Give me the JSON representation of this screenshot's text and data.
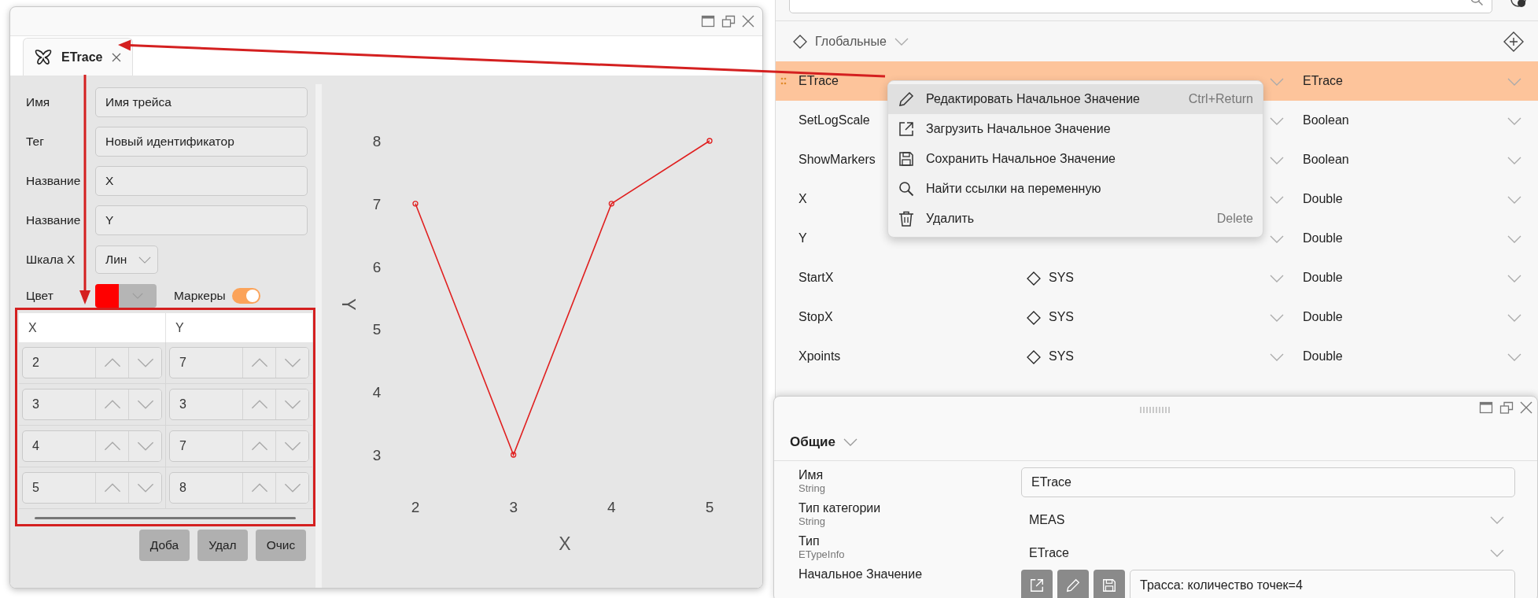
{
  "trace_window": {
    "tab": {
      "label": "ETrace",
      "selected": true
    },
    "form": [
      {
        "label": "Имя",
        "value": "Имя трейса"
      },
      {
        "label": "Тег",
        "value": "Новый идентификатор"
      },
      {
        "label": "Название",
        "value": "X"
      },
      {
        "label": "Название",
        "value": "Y"
      }
    ],
    "scale_x": {
      "label": "Шкала X",
      "value": "Лин"
    },
    "color": {
      "label": "Цвет",
      "color": "#ff0000"
    },
    "markers": {
      "label": "Маркеры",
      "on": true
    },
    "points_table": {
      "columns": [
        "X",
        "Y"
      ],
      "rows": [
        [
          "2",
          "7"
        ],
        [
          "3",
          "3"
        ],
        [
          "4",
          "7"
        ],
        [
          "5",
          "8"
        ]
      ]
    },
    "buttons": [
      "Доба",
      "Удал",
      "Очис"
    ],
    "chart": {
      "chart_data": {
        "type": "line",
        "xlabel": "X",
        "ylabel": "Y",
        "x": [
          2,
          3,
          4,
          5
        ],
        "series": [
          {
            "color": "#e02020",
            "marker": "circle",
            "values": [
              7,
              3,
              7,
              8
            ]
          }
        ],
        "xlim": [
          2,
          5
        ],
        "ylim": [
          3,
          8
        ],
        "xticks": [
          2,
          3,
          4,
          5
        ],
        "yticks": [
          3,
          4,
          5,
          6,
          7,
          8
        ]
      }
    }
  },
  "variables": {
    "group": "Глобальные",
    "rows": [
      {
        "name": "ETrace",
        "type": "ETrace",
        "selected": true
      },
      {
        "name": "SetLogScale",
        "type": "Boolean",
        "selected": false
      },
      {
        "name": "ShowMarkers",
        "type": "Boolean",
        "selected": false
      },
      {
        "name": "X",
        "type": "Double",
        "selected": false
      },
      {
        "name": "Y",
        "type": "Double",
        "selected": false
      },
      {
        "name": "StartX",
        "category": "SYS",
        "type": "Double",
        "selected": false
      },
      {
        "name": "StopX",
        "category": "SYS",
        "type": "Double",
        "selected": false
      },
      {
        "name": "Xpoints",
        "category": "SYS",
        "type": "Double",
        "selected": false
      }
    ]
  },
  "context_menu": [
    {
      "label": "Редактировать Начальное Значение",
      "shortcut": "Ctrl+Return",
      "selected": true
    },
    {
      "label": "Загрузить Начальное Значение",
      "selected": false
    },
    {
      "label": "Сохранить Начальное Значение",
      "selected": false
    },
    {
      "label": "Найти ссылки на переменную",
      "selected": false
    },
    {
      "label": "Удалить",
      "shortcut": "Delete",
      "selected": false
    }
  ],
  "properties_window": {
    "section": "Общие",
    "fields": [
      {
        "kind": "text",
        "label": "Имя",
        "type": "String",
        "value": "ETrace"
      },
      {
        "kind": "dropdown",
        "label": "Тип категории",
        "type": "String",
        "value": "MEAS"
      },
      {
        "kind": "dropdown",
        "label": "Тип",
        "type": "ETypeInfo",
        "value": "ETrace"
      },
      {
        "kind": "editor",
        "label": "Начальное Значение",
        "value": "Трасса: количество точек=4"
      }
    ]
  }
}
